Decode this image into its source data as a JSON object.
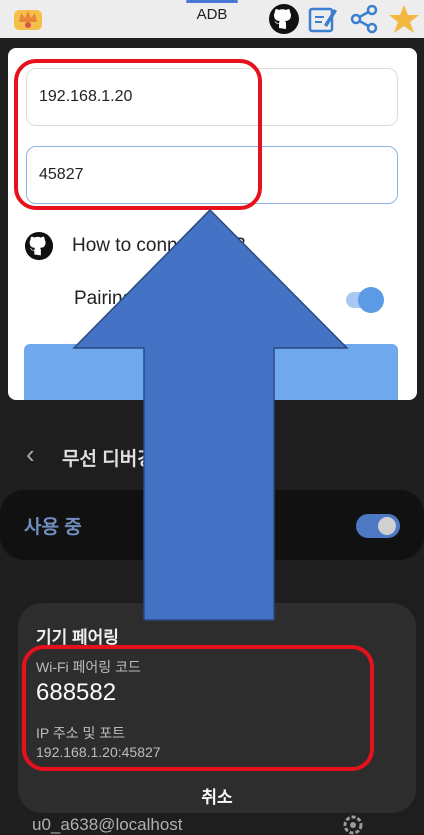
{
  "topbar": {
    "tab_label": "ADB",
    "icons": [
      "crown-icon",
      "github-icon",
      "note-edit-icon",
      "share-icon",
      "star-icon"
    ]
  },
  "panel": {
    "ip_value": "192.168.1.20",
    "port_value": "45827",
    "how_to_text": "How to connect ADB",
    "pairing_text": "Pairing (Android 11+, 14)",
    "pairing_toggle_on": true
  },
  "dark_screen": {
    "header_title": "무선 디버깅",
    "in_use_label": "사용 중",
    "in_use_toggle_on": true,
    "bottom_text": "u0_a638@localhost"
  },
  "dialog": {
    "title": "기기 페어링",
    "code_label": "Wi-Fi 페어링 코드",
    "code_value": "688582",
    "ip_label": "IP 주소 및 포트",
    "ip_value": "192.168.1.20:45827",
    "cancel_label": "취소"
  },
  "colors": {
    "highlight": "#e8101c",
    "arrow_fill": "#4472c4",
    "accent": "#5b9be6"
  }
}
